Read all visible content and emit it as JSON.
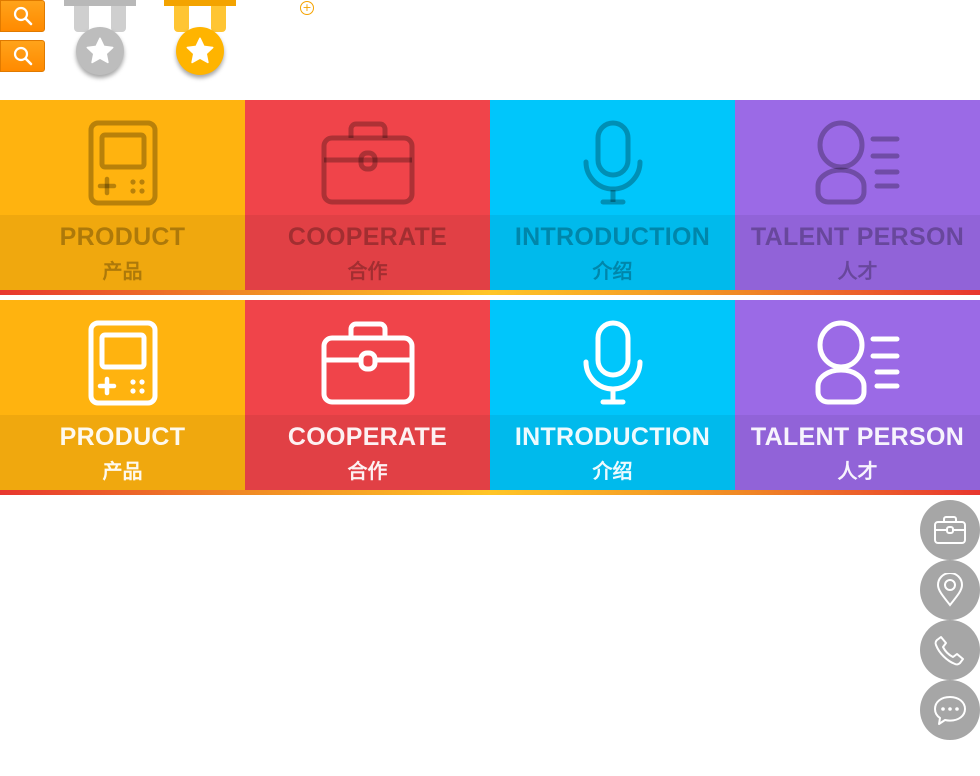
{
  "colors": {
    "product": "#ffb30f",
    "cooperate": "#f0444a",
    "introduction": "#00c6fb",
    "talent": "#9b6ae6",
    "search": "#ff9a0d",
    "side_button": "#a6a6a6"
  },
  "top": {
    "search_icons": [
      "search-icon",
      "search-icon"
    ],
    "medals": [
      {
        "style": "gray",
        "icon": "star-icon"
      },
      {
        "style": "gold",
        "icon": "star-icon"
      }
    ],
    "plus_icon": "plus-circle-icon"
  },
  "rows": [
    {
      "state": "dim",
      "tiles": [
        {
          "icon": "gamepad-icon",
          "en": "PRODUCT",
          "zh": "产品"
        },
        {
          "icon": "briefcase-icon",
          "en": "COOPERATE",
          "zh": "合作"
        },
        {
          "icon": "microphone-icon",
          "en": "INTRODUCTION",
          "zh": "介绍"
        },
        {
          "icon": "person-list-icon",
          "en": "TALENT PERSON",
          "zh": "人才"
        }
      ]
    },
    {
      "state": "highlight",
      "tiles": [
        {
          "icon": "gamepad-icon",
          "en": "PRODUCT",
          "zh": "产品"
        },
        {
          "icon": "briefcase-icon",
          "en": "COOPERATE",
          "zh": "合作"
        },
        {
          "icon": "microphone-icon",
          "en": "INTRODUCTION",
          "zh": "介绍"
        },
        {
          "icon": "person-list-icon",
          "en": "TALENT PERSON",
          "zh": "人才"
        }
      ]
    }
  ],
  "side_buttons": [
    {
      "icon": "briefcase-icon"
    },
    {
      "icon": "location-pin-icon"
    },
    {
      "icon": "phone-icon"
    },
    {
      "icon": "chat-icon"
    }
  ]
}
